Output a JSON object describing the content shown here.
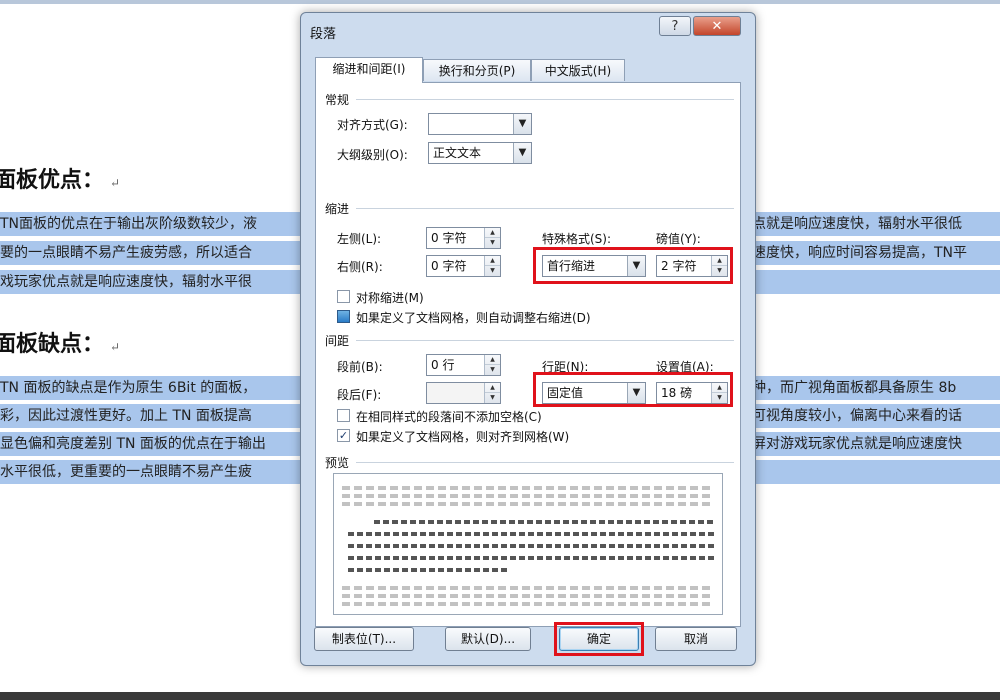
{
  "document": {
    "heading1": "面板优点：",
    "heading2": "面板缺点：",
    "para_mark": "↵",
    "para1": [
      {
        "left": "TN面板的优点在于输出灰阶级数较少，液",
        "right": "点就是响应速度快，辐射水平很低"
      },
      {
        "left": "要的一点眼睛不易产生疲劳感，所以适合",
        "right": "速度快，响应时间容易提高，TN平"
      },
      {
        "left": "戏玩家优点就是响应速度快，辐射水平很",
        "right": ""
      }
    ],
    "para2": [
      {
        "left": "TN 面板的缺点是作为原生 6Bit 的面板，",
        "right": "种，而广视角面板都具备原生 8b"
      },
      {
        "left": "彩，因此过渡性更好。加上 TN 面板提高",
        "right": "可视角度较小，偏离中心来看的话"
      },
      {
        "left": "显色偏和亮度差别 TN 面板的优点在于输出",
        "right": "屏对游戏玩家优点就是响应速度快"
      },
      {
        "left": "水平很低，更重要的一点眼睛不易产生疲",
        "right": ""
      }
    ]
  },
  "dialog": {
    "title": "段落",
    "help_label": "?",
    "close_label": "✕",
    "tabs": [
      "缩进和间距(I)",
      "换行和分页(P)",
      "中文版式(H)"
    ],
    "general": {
      "title": "常规",
      "align_label": "对齐方式(G):",
      "align_value": "",
      "outline_label": "大纲级别(O):",
      "outline_value": "正文文本"
    },
    "indent": {
      "title": "缩进",
      "left_label": "左侧(L):",
      "left_value": "0 字符",
      "right_label": "右侧(R):",
      "right_value": "0 字符",
      "special_label": "特殊格式(S):",
      "special_value": "首行缩进",
      "measure_label": "磅值(Y):",
      "measure_value": "2 字符",
      "mirror_label": "对称缩进(M)",
      "auto_label": "如果定义了文档网格，则自动调整右缩进(D)"
    },
    "spacing": {
      "title": "间距",
      "before_label": "段前(B):",
      "before_value": "0 行",
      "after_label": "段后(F):",
      "after_value": "",
      "line_label": "行距(N):",
      "line_value": "固定值",
      "at_label": "设置值(A):",
      "at_value": "18 磅",
      "no_space_label": "在相同样式的段落间不添加空格(C)",
      "snap_label": "如果定义了文档网格，则对齐到网格(W)"
    },
    "preview": {
      "title": "预览",
      "sample": [
        "TN 面板的优点在于输出灰阶级数较少，液晶分子偏转速度快，响应时间容易",
        "提高，TN 平面对游戏玩家优点就是响应速度快，辐射水平很低，更重要的一点眼睛不易产",
        "生疲劳感，所以适合游戏玩家 TN 面板的优点在于输出灰阶级数较少，液晶分子偏转速度快，",
        "响应时间容易提高，TN 平面对游戏玩家优点就是响应速度快，辐射水平很低，更重要的一点",
        "眼睛不易产生疲劳感，所以适合游戏玩家"
      ]
    },
    "buttons": {
      "tabs": "制表位(T)...",
      "default": "默认(D)...",
      "ok": "确定",
      "cancel": "取消"
    }
  }
}
